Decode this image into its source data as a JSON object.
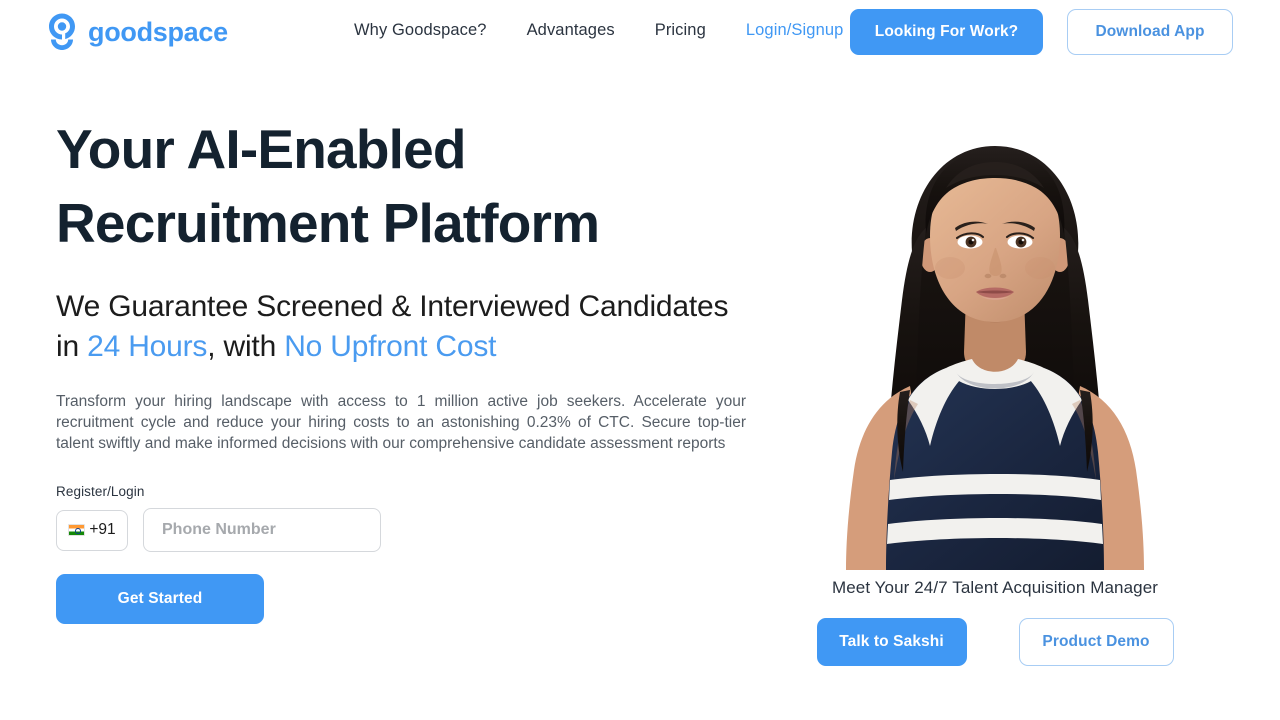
{
  "brand": {
    "name": "goodspace",
    "logo_icon": "goodspace-g-logo",
    "color": "#4098f4"
  },
  "nav": {
    "items": [
      {
        "label": "Why Goodspace?",
        "accent": false
      },
      {
        "label": "Advantages",
        "accent": false
      },
      {
        "label": "Pricing",
        "accent": false
      },
      {
        "label": "Login/Signup",
        "accent": true
      }
    ]
  },
  "header_actions": {
    "looking_for_work": "Looking For Work?",
    "download_app": "Download App"
  },
  "hero": {
    "headline_line1": "Your AI-Enabled",
    "headline_line2": "Recruitment Platform",
    "subheadline": {
      "part1": "We Guarantee Screened & Interviewed Candidates in ",
      "highlight1": "24 Hours",
      "part2": ", with ",
      "highlight2": "No Upfront Cost"
    },
    "body": "Transform your hiring landscape with access to 1 million active job seekers. Accelerate your recruitment cycle and reduce your hiring costs to an astonishing 0.23% of CTC. Secure top-tier talent swiftly and make informed decisions with our comprehensive candidate assessment reports"
  },
  "form": {
    "label": "Register/Login",
    "country_code": "+91",
    "country_flag": "india-flag-icon",
    "phone_placeholder": "Phone Number",
    "phone_value": "",
    "submit_label": "Get Started"
  },
  "right_panel": {
    "portrait_alt": "talent-acquisition-manager-portrait",
    "caption": "Meet Your 24/7 Talent Acquisition Manager",
    "talk_button": "Talk to Sakshi",
    "demo_button": "Product Demo"
  },
  "colors": {
    "primary_blue": "#4098f4",
    "link_blue": "#4a9bf0",
    "outline_blue": "#4a92e0",
    "heading_navy": "#14222f",
    "body_gray": "#565e67",
    "border_gray": "#d5d8dc",
    "page_background": "#ffffff"
  }
}
